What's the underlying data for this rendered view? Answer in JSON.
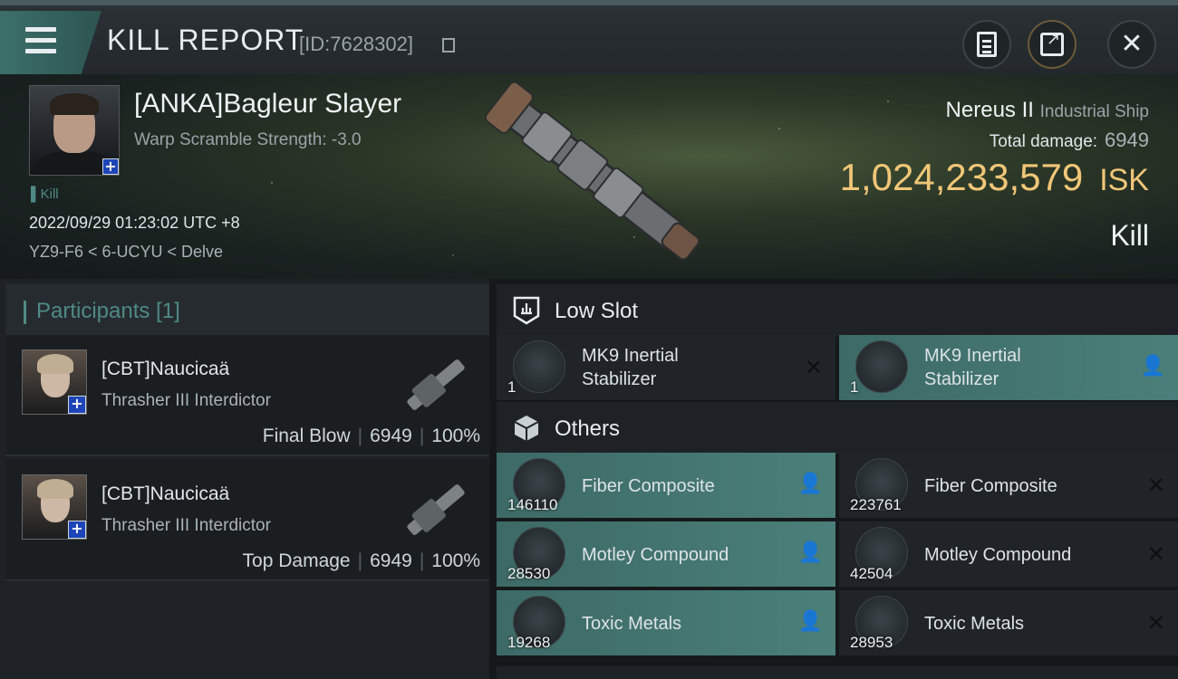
{
  "header": {
    "title": "KILL REPORT",
    "report_id": "[ID:7628302]"
  },
  "victim": {
    "name": "[ANKA]Bagleur Slayer",
    "warp_scramble": "Warp Scramble Strength: -3.0",
    "tag": "Kill",
    "datetime": "2022/09/29 01:23:02 UTC +8",
    "location": "YZ9-F6 < 6-UCYU < Delve"
  },
  "ship": {
    "name": "Nereus II",
    "class": "Industrial Ship",
    "total_damage_label": "Total damage:",
    "total_damage": "6949",
    "isk_value": "1,024,233,579",
    "isk_unit": "ISK",
    "result": "Kill"
  },
  "participants": {
    "title": "Participants [1]",
    "list": [
      {
        "name": "[CBT]Naucicaä",
        "ship": "Thrasher III Interdictor",
        "role": "Final Blow",
        "damage": "6949",
        "percent": "100%"
      },
      {
        "name": "[CBT]Naucicaä",
        "ship": "Thrasher III Interdictor",
        "role": "Top Damage",
        "damage": "6949",
        "percent": "100%"
      }
    ],
    "sep": "|"
  },
  "sections": {
    "low_slot": "Low Slot",
    "others": "Others"
  },
  "items": {
    "low": [
      {
        "name1": "MK9 Inertial",
        "name2": "Stabilizer",
        "qty": "1",
        "status": "destroyed"
      },
      {
        "name1": "MK9 Inertial",
        "name2": "Stabilizer",
        "qty": "1",
        "status": "dropped"
      }
    ],
    "others": [
      {
        "name": "Fiber Composite",
        "qty": "146110",
        "status": "dropped"
      },
      {
        "name": "Fiber Composite",
        "qty": "223761",
        "status": "destroyed"
      },
      {
        "name": "Motley Compound",
        "qty": "28530",
        "status": "dropped"
      },
      {
        "name": "Motley Compound",
        "qty": "42504",
        "status": "destroyed"
      },
      {
        "name": "Toxic Metals",
        "qty": "19268",
        "status": "dropped"
      },
      {
        "name": "Toxic Metals",
        "qty": "28953",
        "status": "destroyed"
      }
    ]
  },
  "icons": {
    "dropped": "person-icon",
    "destroyed": "close-icon"
  },
  "colors": {
    "accent_teal": "#4f8a86",
    "isk_gold": "#f0c678",
    "highlight_row": "#4b7f7a"
  }
}
